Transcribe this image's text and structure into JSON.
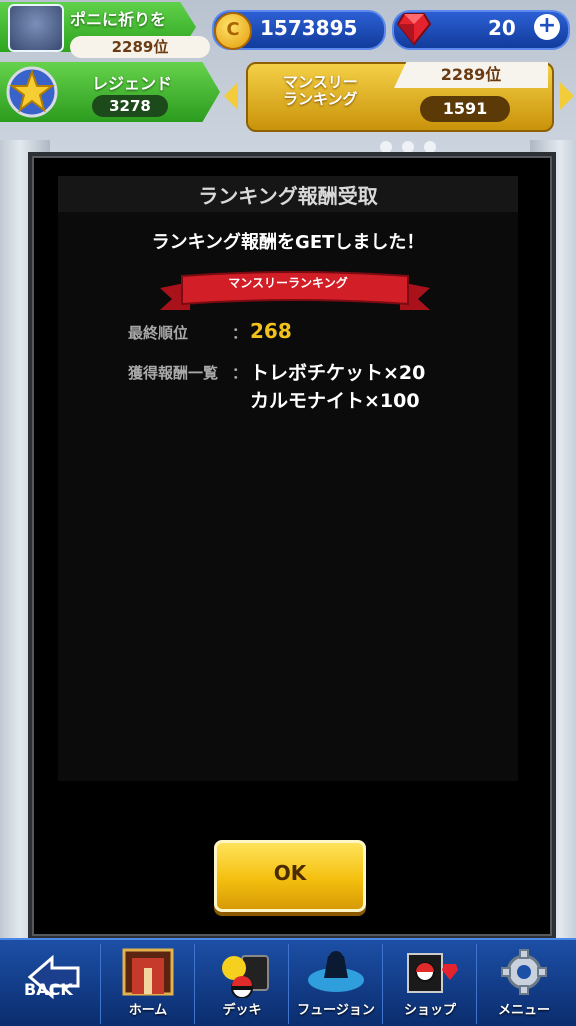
{
  "player": {
    "name": "ポニに祈りを",
    "rank": "2289位"
  },
  "league": {
    "name": "レジェンド",
    "points": "3278"
  },
  "currency": {
    "coins": "1573895",
    "gems": "20",
    "coin_icon_text": "C"
  },
  "monthly_ranking": {
    "title": "マンスリー\nランキング",
    "rank": "2289位",
    "points": "1591"
  },
  "dialog": {
    "title": "ランキング報酬受取",
    "message": "ランキング報酬をGETしました！",
    "ribbon": "マンスリーランキング",
    "final_rank_label": "最終順位",
    "final_rank_value": "268",
    "rewards_label": "獲得報酬一覧",
    "rewards": [
      "トレボチケット×20",
      "カルモナイト×100"
    ],
    "colon": "：",
    "ok_label": "OK"
  },
  "nav": {
    "back": "BACK",
    "items": [
      "ホーム",
      "デッキ",
      "フュージョン",
      "ショップ",
      "メニュー"
    ]
  },
  "colors": {
    "accent_gold": "#f2c21b",
    "nav_blue": "#1c4fa6",
    "green": "#2ea41f"
  }
}
